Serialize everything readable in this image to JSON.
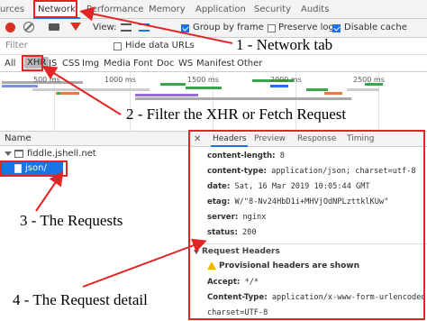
{
  "tabs": [
    "urces",
    "Network",
    "Performance",
    "Memory",
    "Application",
    "Security",
    "Audits"
  ],
  "toolbar": {
    "view_label": "View:",
    "group_by_frame": "Group by frame",
    "preserve_log": "Preserve log",
    "disable_cache": "Disable cache"
  },
  "filter": {
    "placeholder": "Filter",
    "hide_data_urls": "Hide data URLs"
  },
  "types": [
    "All",
    "XHR",
    "JS",
    "CSS",
    "Img",
    "Media",
    "Font",
    "Doc",
    "WS",
    "Manifest",
    "Other"
  ],
  "timeline": {
    "ticks": [
      "500 ms",
      "1000 ms",
      "1500 ms",
      "2000 ms",
      "2500 ms"
    ]
  },
  "requests": {
    "name_header": "Name",
    "rows": [
      {
        "label": "fiddle.jshell.net"
      },
      {
        "label": "json/"
      }
    ]
  },
  "details": {
    "tabs": [
      "Headers",
      "Preview",
      "Response",
      "Timing"
    ],
    "close": "✕",
    "response_headers": [
      {
        "key": "content-length:",
        "value": "8"
      },
      {
        "key": "content-type:",
        "value": "application/json; charset=utf-8"
      },
      {
        "key": "date:",
        "value": "Sat, 16 Mar 2019 10:05:44 GMT"
      },
      {
        "key": "etag:",
        "value": "W/\"8-Nv24HbD1i+MHVjOdNPLzttklKUw\""
      },
      {
        "key": "server:",
        "value": "nginx"
      },
      {
        "key": "status:",
        "value": "200"
      }
    ],
    "request_headers_title": "Request Headers",
    "provisional_warning": "Provisional headers are shown",
    "request_headers": [
      {
        "key": "Accept:",
        "value": "*/*"
      },
      {
        "key": "Content-Type:",
        "value": "application/x-www-form-urlencoded;"
      },
      {
        "key": "",
        "value": "charset=UTF-8"
      }
    ]
  },
  "annotations": {
    "a1": "1 - Network tab",
    "a2": "2 - Filter the XHR or Fetch Request",
    "a3": "3 - The Requests",
    "a4": "4 - The Request detail"
  },
  "colors": {
    "annotation_red": "#e32424",
    "accent_blue": "#1a73e8",
    "selected_row": "#1a73e8",
    "record_red": "#d93025"
  }
}
